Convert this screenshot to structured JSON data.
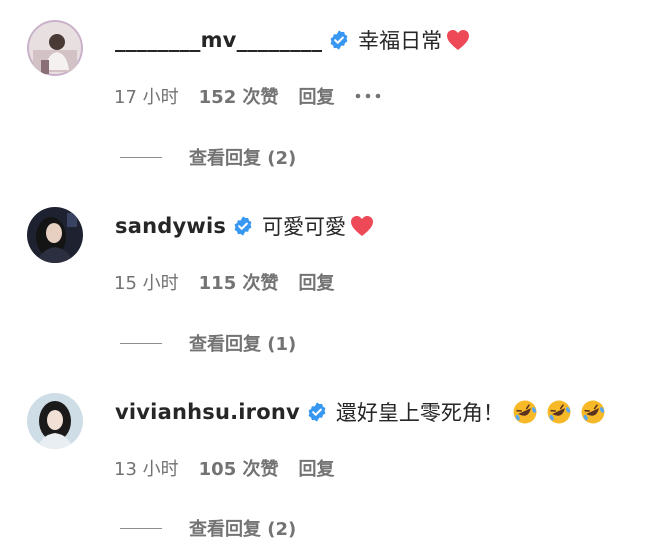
{
  "comments": [
    {
      "username": "________mv________",
      "text": "幸福日常",
      "time": "17 小时",
      "likes": "152 次赞",
      "reply": "回复",
      "more": "•••",
      "view_replies": "查看回复 (2)",
      "verified": true,
      "reaction": "red-heart"
    },
    {
      "username": "sandywis",
      "text": "可愛可愛",
      "time": "15 小时",
      "likes": "115 次赞",
      "reply": "回复",
      "view_replies": "查看回复 (1)",
      "verified": true,
      "reaction": "red-heart"
    },
    {
      "username": "vivianhsu.ironv",
      "text": "還好皇上零死角！",
      "time": "13 小时",
      "likes": "105 次赞",
      "reply": "回复",
      "view_replies": "查看回复 (2)",
      "verified": true,
      "reaction": "rolling-on-floor-laughing x3"
    }
  ],
  "colors": {
    "text": "#262626",
    "secondary": "#737373",
    "verified_blue": "#3897f0",
    "heart_red": "#ed4956"
  }
}
